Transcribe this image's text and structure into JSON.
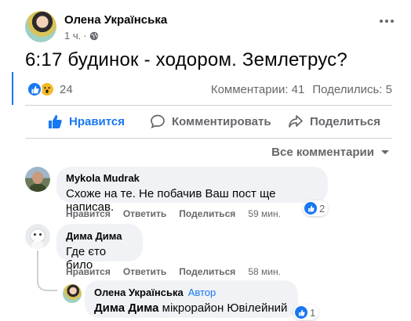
{
  "post": {
    "author": "Олена Українська",
    "time": "1 ч.",
    "text": "6:17 будинок - ходором. Землетрус?",
    "reaction_count": "24",
    "comments_count": "Комментарии: 41",
    "shares_count": "Поделились: 5"
  },
  "actions": {
    "like": "Нравится",
    "comment": "Комментировать",
    "share": "Поделиться"
  },
  "filter": {
    "label": "Все комментарии"
  },
  "comments": [
    {
      "author": "Mykola Mudrak",
      "text": "Схоже на те. Не побачив Ваш пост ще написав.",
      "like_label": "Нравится",
      "reply_label": "Ответить",
      "share_label": "Поделиться",
      "time": "59 мин.",
      "reactions": "2"
    },
    {
      "author": "Дима Дима",
      "text": "Где єто било",
      "like_label": "Нравится",
      "reply_label": "Ответить",
      "share_label": "Поделиться",
      "time": "58 мин."
    }
  ],
  "reply": {
    "author": "Олена Українська",
    "badge": "Автор",
    "mention": "Дима Дима",
    "text": "мікрорайон Ювілейний",
    "reactions": "1"
  },
  "colors": {
    "accent": "#1877f2",
    "muted": "#65676b",
    "bubble": "#f0f2f5"
  }
}
